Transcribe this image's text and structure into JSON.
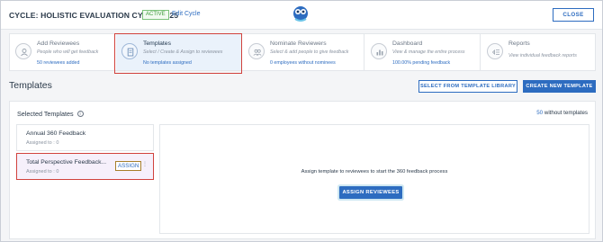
{
  "header": {
    "cycle_title": "CYCLE: HOLISTIC EVALUATION CYCLE 2025",
    "status": "ACTIVE",
    "edit_link": "Edit Cycle",
    "close_label": "CLOSE"
  },
  "steps": [
    {
      "title": "Add Reviewees",
      "subtitle": "People who will get feedback",
      "link": "50  reviewees added",
      "icon": "person-icon"
    },
    {
      "title": "Templates",
      "subtitle": "Select / Create & Assign to reviewees",
      "link": "No templates assigned",
      "icon": "document-icon"
    },
    {
      "title": "Nominate Reviewers",
      "subtitle": "Select & add people to give feedback",
      "link": "0  employees without nominees",
      "icon": "people-icon"
    },
    {
      "title": "Dashboard",
      "subtitle": "View & manage the entire process",
      "link": "100.00% pending feedback",
      "icon": "chart-icon"
    },
    {
      "title": "Reports",
      "subtitle": "View individual feedback reports",
      "link": "",
      "icon": "report-icon"
    }
  ],
  "templates_section": {
    "title": "Templates",
    "library_button": "SELECT FROM TEMPLATE LIBRARY",
    "create_button": "CREATE NEW TEMPLATE",
    "selected_label": "Selected Templates",
    "without_count": "50",
    "without_label": " without templates",
    "items": [
      {
        "title": "Annual 360 Feedback",
        "subtitle": "Assigned to : 0"
      },
      {
        "title": "Total Perspective Feedback...",
        "subtitle": "Assigned to : 0",
        "action": "ASSIGN"
      }
    ],
    "assign_message": "Assign template to reviewees to start the 360 feedback process",
    "assign_button": "ASSIGN REVIEWEES"
  },
  "colors": {
    "accent": "#2d6cc0",
    "highlight": "#d1423d",
    "status_green": "#3b9a38"
  }
}
